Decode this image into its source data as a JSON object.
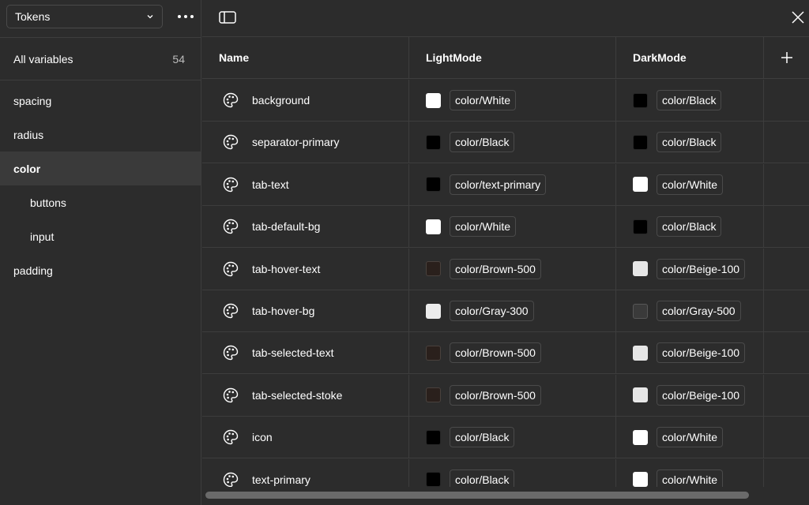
{
  "sidebar": {
    "collection": "Tokens",
    "all_variables_label": "All variables",
    "all_variables_count": "54",
    "groups": [
      {
        "label": "spacing",
        "level": 0,
        "selected": false
      },
      {
        "label": "radius",
        "level": 0,
        "selected": false
      },
      {
        "label": "color",
        "level": 0,
        "selected": true
      },
      {
        "label": "buttons",
        "level": 1,
        "selected": false
      },
      {
        "label": "input",
        "level": 1,
        "selected": false
      },
      {
        "label": "padding",
        "level": 0,
        "selected": false
      }
    ]
  },
  "table": {
    "columns": [
      "Name",
      "LightMode",
      "DarkMode"
    ],
    "rows": [
      {
        "name": "background",
        "light": {
          "color": "#ffffff",
          "label": "color/White"
        },
        "dark": {
          "color": "#000000",
          "label": "color/Black"
        }
      },
      {
        "name": "separator-primary",
        "light": {
          "color": "#000000",
          "label": "color/Black"
        },
        "dark": {
          "color": "#000000",
          "label": "color/Black"
        }
      },
      {
        "name": "tab-text",
        "light": {
          "color": "#000000",
          "label": "color/text-primary"
        },
        "dark": {
          "color": "#ffffff",
          "label": "color/White"
        }
      },
      {
        "name": "tab-default-bg",
        "light": {
          "color": "#ffffff",
          "label": "color/White"
        },
        "dark": {
          "color": "#000000",
          "label": "color/Black"
        }
      },
      {
        "name": "tab-hover-text",
        "light": {
          "color": "#2a201c",
          "label": "color/Brown-500"
        },
        "dark": {
          "color": "#e6e6e6",
          "label": "color/Beige-100"
        }
      },
      {
        "name": "tab-hover-bg",
        "light": {
          "color": "#ececec",
          "label": "color/Gray-300"
        },
        "dark": {
          "color": "#3a3a3a",
          "label": "color/Gray-500"
        }
      },
      {
        "name": "tab-selected-text",
        "light": {
          "color": "#2a201c",
          "label": "color/Brown-500"
        },
        "dark": {
          "color": "#e6e6e6",
          "label": "color/Beige-100"
        }
      },
      {
        "name": "tab-selected-stoke",
        "light": {
          "color": "#2a201c",
          "label": "color/Brown-500"
        },
        "dark": {
          "color": "#e6e6e6",
          "label": "color/Beige-100"
        }
      },
      {
        "name": "icon",
        "light": {
          "color": "#000000",
          "label": "color/Black"
        },
        "dark": {
          "color": "#ffffff",
          "label": "color/White"
        }
      },
      {
        "name": "text-primary",
        "light": {
          "color": "#000000",
          "label": "color/Black"
        },
        "dark": {
          "color": "#ffffff",
          "label": "color/White"
        }
      }
    ]
  },
  "icons": {
    "chevron": "chevron-down-icon",
    "more": "more-horizontal-icon",
    "panel": "sidebar-toggle-icon",
    "close": "close-icon",
    "add": "plus-icon",
    "variable": "palette-icon"
  },
  "colors": {
    "background": "#2c2c2c",
    "border": "#3d3d3d",
    "selected_row": "#3a3a3a",
    "scroll_thumb": "#6a6a6a"
  }
}
